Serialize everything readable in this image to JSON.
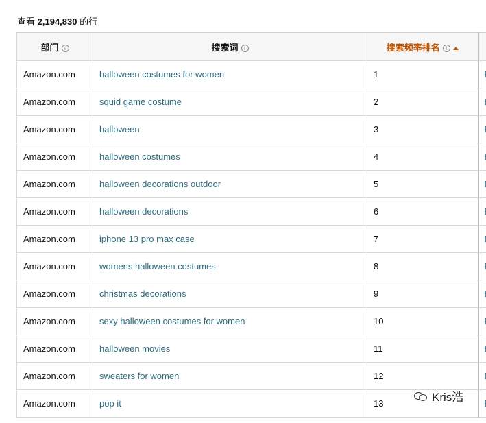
{
  "summary": {
    "prefix": "查看",
    "count": "2,194,830",
    "suffix": "的行"
  },
  "table": {
    "columns": [
      {
        "label": "部门",
        "info": "i"
      },
      {
        "label": "搜索词",
        "info": "i"
      },
      {
        "label": "搜索频率排名",
        "info": "i",
        "sorted": "asc"
      }
    ],
    "rows": [
      {
        "department": "Amazon.com",
        "term": "halloween costumes for women",
        "rank": "1",
        "extra": "E"
      },
      {
        "department": "Amazon.com",
        "term": "squid game costume",
        "rank": "2",
        "extra": "E"
      },
      {
        "department": "Amazon.com",
        "term": "halloween",
        "rank": "3",
        "extra": "E"
      },
      {
        "department": "Amazon.com",
        "term": "halloween costumes",
        "rank": "4",
        "extra": "E"
      },
      {
        "department": "Amazon.com",
        "term": "halloween decorations outdoor",
        "rank": "5",
        "extra": "E"
      },
      {
        "department": "Amazon.com",
        "term": "halloween decorations",
        "rank": "6",
        "extra": "E"
      },
      {
        "department": "Amazon.com",
        "term": "iphone 13 pro max case",
        "rank": "7",
        "extra": "E"
      },
      {
        "department": "Amazon.com",
        "term": "womens halloween costumes",
        "rank": "8",
        "extra": "E"
      },
      {
        "department": "Amazon.com",
        "term": "christmas decorations",
        "rank": "9",
        "extra": "E"
      },
      {
        "department": "Amazon.com",
        "term": "sexy halloween costumes for women",
        "rank": "10",
        "extra": "E"
      },
      {
        "department": "Amazon.com",
        "term": "halloween movies",
        "rank": "11",
        "extra": "E"
      },
      {
        "department": "Amazon.com",
        "term": "sweaters for women",
        "rank": "12",
        "extra": "E"
      },
      {
        "department": "Amazon.com",
        "term": "pop it",
        "rank": "13",
        "extra": "E"
      }
    ]
  },
  "watermark": {
    "text": "Kris浩",
    "icon": "wechat-icon"
  },
  "colors": {
    "link": "#2e6c80",
    "sorted_header": "#c45500",
    "border": "#d5d9d9",
    "header_bg": "#f6f6f6"
  }
}
